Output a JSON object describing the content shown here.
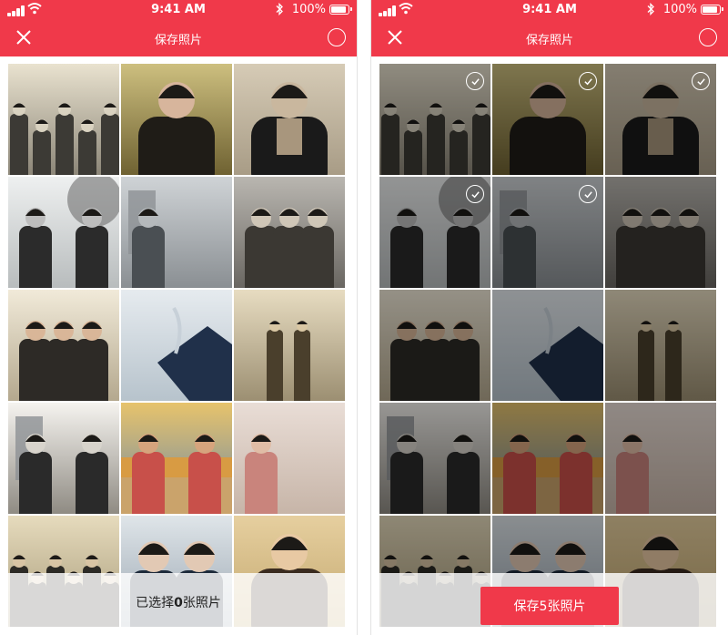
{
  "status_bar": {
    "time": "9:41 AM",
    "battery": "100%"
  },
  "header": {
    "title": "保存照片"
  },
  "left_screen": {
    "selected_prefix": "已选择",
    "selected_count": "0",
    "selected_suffix": "张照片"
  },
  "right_screen": {
    "save_label": "保存5张照片"
  },
  "colors": {
    "accent": "#f0394a"
  },
  "photos": [
    {
      "kind": "group-photo-with-handwritten-caption",
      "selected": true
    },
    {
      "kind": "smiling-woman-portrait",
      "selected": true
    },
    {
      "kind": "woman-with-checked-scarf",
      "selected": true
    },
    {
      "kind": "couple-under-tree",
      "selected": true
    },
    {
      "kind": "woman-by-building",
      "selected": true
    },
    {
      "kind": "family-with-two-children",
      "selected": false
    },
    {
      "kind": "couple-with-baby",
      "selected": false
    },
    {
      "kind": "torn-faded-photo",
      "selected": false
    },
    {
      "kind": "woman-and-child-standing",
      "selected": false
    },
    {
      "kind": "couple-standing-outdoors",
      "selected": false
    },
    {
      "kind": "couple-at-beach-sunset",
      "selected": false
    },
    {
      "kind": "woman-sitting-on-blanket",
      "selected": false
    },
    {
      "kind": "group-family-portrait",
      "selected": false
    },
    {
      "kind": "couple-portrait",
      "selected": false
    },
    {
      "kind": "woman-portrait",
      "selected": false
    }
  ]
}
